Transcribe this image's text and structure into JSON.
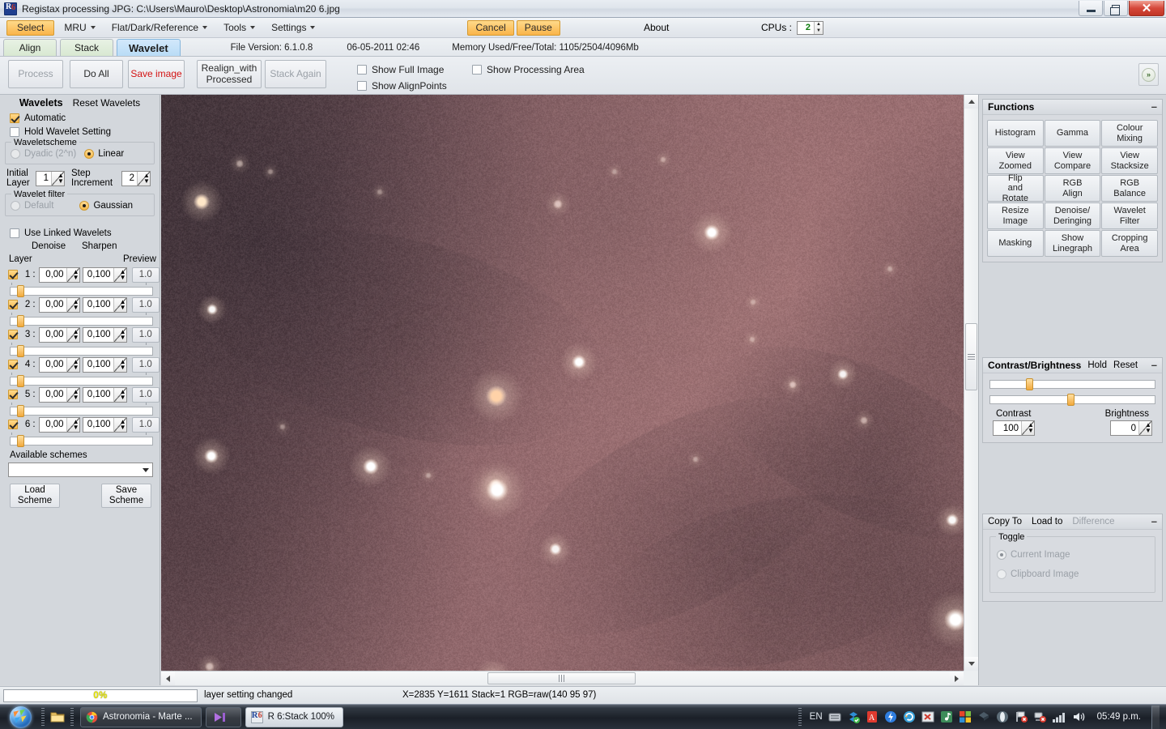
{
  "window": {
    "title": "Registax processing JPG: C:\\Users\\Mauro\\Desktop\\Astronomia\\m20 6.jpg",
    "app_icon": "registax-icon",
    "minimize": "minimize-icon",
    "maximize": "maximize-icon",
    "close": "close-icon"
  },
  "menubar": {
    "select": "Select",
    "items": [
      {
        "label": "MRU",
        "caret": true
      },
      {
        "label": "Flat/Dark/Reference",
        "caret": true
      },
      {
        "label": "Tools",
        "caret": true
      },
      {
        "label": "Settings",
        "caret": true
      }
    ],
    "cancel": "Cancel",
    "pause": "Pause",
    "about": "About",
    "cpus_label": "CPUs :",
    "cpus_value": "2"
  },
  "tabs": [
    {
      "label": "Align",
      "active": false
    },
    {
      "label": "Stack",
      "active": false
    },
    {
      "label": "Wavelet",
      "active": true
    }
  ],
  "tabinfo": {
    "file_version": "File Version: 6.1.0.8",
    "datetime": "06-05-2011 02:46",
    "memory": "Memory Used/Free/Total: 1105/2504/4096Mb"
  },
  "toolbar": {
    "process": "Process",
    "do_all": "Do All",
    "save_image": "Save image",
    "realign": "Realign_with Processed",
    "stack_again": "Stack Again",
    "show_full_image": {
      "label": "Show Full Image",
      "checked": false
    },
    "show_alignpoints": {
      "label": "Show AlignPoints",
      "checked": false
    },
    "show_processing_area": {
      "label": "Show Processing Area",
      "checked": false
    },
    "expand": "expand-icon",
    "expand_glyph": "»"
  },
  "wavelets": {
    "title": "Wavelets",
    "reset": "Reset Wavelets",
    "automatic": {
      "label": "Automatic",
      "checked": true
    },
    "hold": {
      "label": "Hold Wavelet Setting",
      "checked": false
    },
    "scheme_legend": "Waveletscheme",
    "scheme_dyadic": {
      "label": "Dyadic (2^n)",
      "selected": false
    },
    "scheme_linear": {
      "label": "Linear",
      "selected": true
    },
    "initial_layer_label": "Initial Layer",
    "initial_layer_value": "1",
    "step_increment_label": "Step Increment",
    "step_increment_value": "2",
    "filter_legend": "Wavelet filter",
    "filter_default": {
      "label": "Default",
      "selected": false
    },
    "filter_gaussian": {
      "label": "Gaussian",
      "selected": true
    },
    "use_linked": {
      "label": "Use Linked Wavelets",
      "checked": false
    },
    "col_denoise": "Denoise",
    "col_sharpen": "Sharpen",
    "col_layer": "Layer",
    "col_preview": "Preview",
    "layers": [
      {
        "num": "1",
        "checked": true,
        "denoise": "0,00",
        "sharpen": "0,100",
        "preview": "1.0",
        "slider": 5
      },
      {
        "num": "2",
        "checked": true,
        "denoise": "0,00",
        "sharpen": "0,100",
        "preview": "1.0",
        "slider": 5
      },
      {
        "num": "3",
        "checked": true,
        "denoise": "0,00",
        "sharpen": "0,100",
        "preview": "1.0",
        "slider": 5
      },
      {
        "num": "4",
        "checked": true,
        "denoise": "0,00",
        "sharpen": "0,100",
        "preview": "1.0",
        "slider": 5
      },
      {
        "num": "5",
        "checked": true,
        "denoise": "0,00",
        "sharpen": "0,100",
        "preview": "1.0",
        "slider": 5
      },
      {
        "num": "6",
        "checked": true,
        "denoise": "0,00",
        "sharpen": "0,100",
        "preview": "1.0",
        "slider": 5
      }
    ],
    "available_schemes_label": "Available schemes",
    "available_schemes_value": "",
    "load_scheme": "Load Scheme",
    "save_scheme": "Save Scheme"
  },
  "functions": {
    "title": "Functions",
    "minimize_glyph": "–",
    "buttons": [
      "Histogram",
      "Gamma",
      "Colour Mixing",
      "View Zoomed",
      "View Compare",
      "View Stacksize",
      "Flip and Rotate",
      "RGB Align",
      "RGB Balance",
      "Resize Image",
      "Denoise/ Deringing",
      "Wavelet Filter",
      "Masking",
      "Show Linegraph",
      "Cropping Area"
    ]
  },
  "contrast_brightness": {
    "title": "Contrast/Brightness",
    "hold": "Hold",
    "reset": "Reset",
    "minimize_glyph": "–",
    "contrast_label": "Contrast",
    "contrast_value": "100",
    "brightness_label": "Brightness",
    "brightness_value": "0",
    "contrast_slider_pct": 22,
    "brightness_slider_pct": 47
  },
  "copyto": {
    "copy_to": "Copy To",
    "load_to": "Load to",
    "difference": "Difference",
    "minimize_glyph": "–",
    "toggle_legend": "Toggle",
    "current_image": {
      "label": "Current Image",
      "selected": true
    },
    "clipboard_image": {
      "label": "Clipboard Image",
      "selected": false
    }
  },
  "statusbar": {
    "progress_text": "0%",
    "message": "layer setting changed",
    "coords": "X=2835 Y=1611 Stack=1 RGB=raw(140 95 97)"
  },
  "taskbar": {
    "start": "start-orb-icon",
    "quicklaunch": [
      {
        "name": "explorer-icon"
      }
    ],
    "items": [
      {
        "label": "Astronomia - Marte ...",
        "icon": "chrome-icon",
        "active": false
      },
      {
        "label": "",
        "icon": "media-icon",
        "active": false
      },
      {
        "label": "R 6:Stack 100%",
        "icon": "registax-icon",
        "active": true
      }
    ],
    "lang": "EN",
    "tray_icons": [
      "keyboard-icon",
      "dropbox-icon",
      "acrobat-icon",
      "thunderbolt-icon",
      "recuva-icon",
      "excel-x-icon",
      "music-icon",
      "windows-colors-icon",
      "dropbox-blue-icon",
      "opera-icon",
      "flag-error-icon",
      "network-error-icon"
    ],
    "signal": "signal-icon",
    "volume": "volume-icon",
    "clock": "05:49 p.m."
  },
  "image": {
    "name": "m20-nebula-preview",
    "base_color": "#8c6165",
    "dark_color": "#3b2d32"
  }
}
